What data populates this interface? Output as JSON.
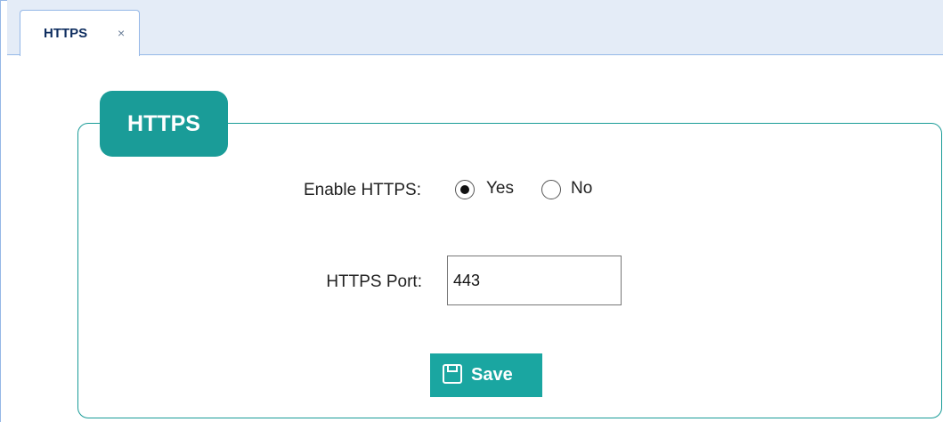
{
  "tabs": [
    {
      "label": "HTTPS",
      "close": "×",
      "active": true
    }
  ],
  "panel": {
    "legend": "HTTPS"
  },
  "form": {
    "enable_label": "Enable HTTPS:",
    "enable_options": [
      {
        "label": "Yes",
        "checked": true
      },
      {
        "label": "No",
        "checked": false
      }
    ],
    "port_label": "HTTPS Port:",
    "port_value": "443"
  },
  "actions": {
    "save_label": "Save",
    "save_icon": "save-icon"
  },
  "colors": {
    "accent": "#1a9c98",
    "button": "#1aa6a1",
    "tab_bar": "#e4ecf7",
    "tab_border": "#95b8e7"
  }
}
